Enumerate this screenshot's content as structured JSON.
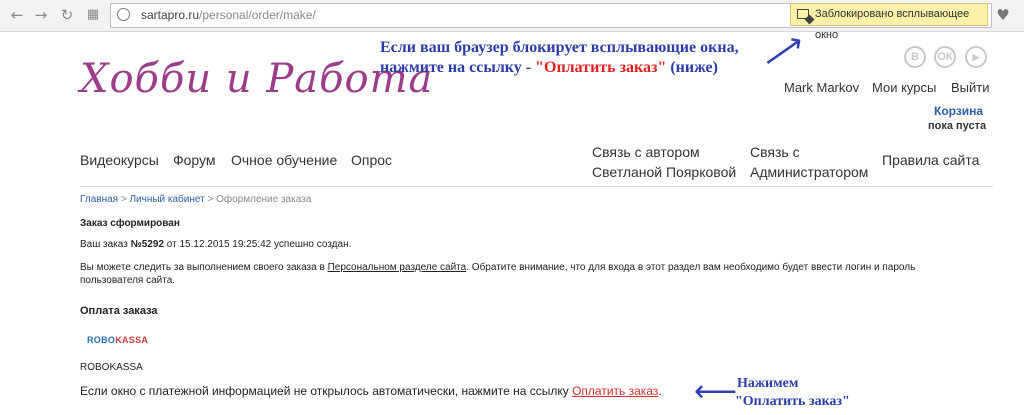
{
  "browser": {
    "url_domain": "sartapro.ru",
    "url_path": "/personal/order/make/",
    "popup_blocked_text": "Заблокировано всплывающее окно"
  },
  "site": {
    "logo_text": "Хобби и Работа",
    "user_name": "Mark Markov",
    "my_courses": "Мои курсы",
    "logout": "Выйти",
    "cart_title": "Корзина",
    "cart_status": "пока пуста",
    "social": [
      "В",
      "ОК",
      "▶"
    ]
  },
  "annotations": {
    "top_line1": "Если ваш браузер блокирует всплывающие окна,",
    "top_line2_prefix": "нажмите на ссылку - ",
    "top_line2_link": "\"Оплатить заказ\"",
    "top_line2_suffix": " (ниже)",
    "bottom_line1": "Нажимем",
    "bottom_line2": "\"Оплатить заказ\""
  },
  "nav": {
    "video": "Видеокурсы",
    "forum": "Форум",
    "offline": "Очное обучение",
    "poll": "Опрос",
    "author_line1": "Связь с автором",
    "author_line2": "Светланой Поярковой",
    "admin_line1": "Связь с",
    "admin_line2": "Администратором",
    "rules": "Правила сайта"
  },
  "breadcrumbs": {
    "home": "Главная",
    "sep1": " > ",
    "account": "Личный кабинет",
    "sep2": " > ",
    "current": "Оформление заказа"
  },
  "order": {
    "heading": "Заказ сформирован",
    "line_prefix": "Ваш заказ ",
    "order_no": "№5292",
    "line_suffix": " от 15.12.2015 19:25:42 успешно создан.",
    "track_prefix": "Вы можете следить за выполнением своего заказа в ",
    "track_link": "Персональном разделе сайта",
    "track_suffix": ". Обратите внимание, что для входа в этот раздел вам необходимо будет ввести логин и пароль",
    "track_line2": "пользователя сайта."
  },
  "payment": {
    "heading": "Оплата заказа",
    "logo_part1": "ROBO",
    "logo_part2": "KASSA",
    "method_name": "ROBOKASSA",
    "prompt": "Если окно с платежной информацией не открылось автоматически, нажмите на ссылку ",
    "pay_link": "Оплатить заказ",
    "prompt_end": "."
  }
}
